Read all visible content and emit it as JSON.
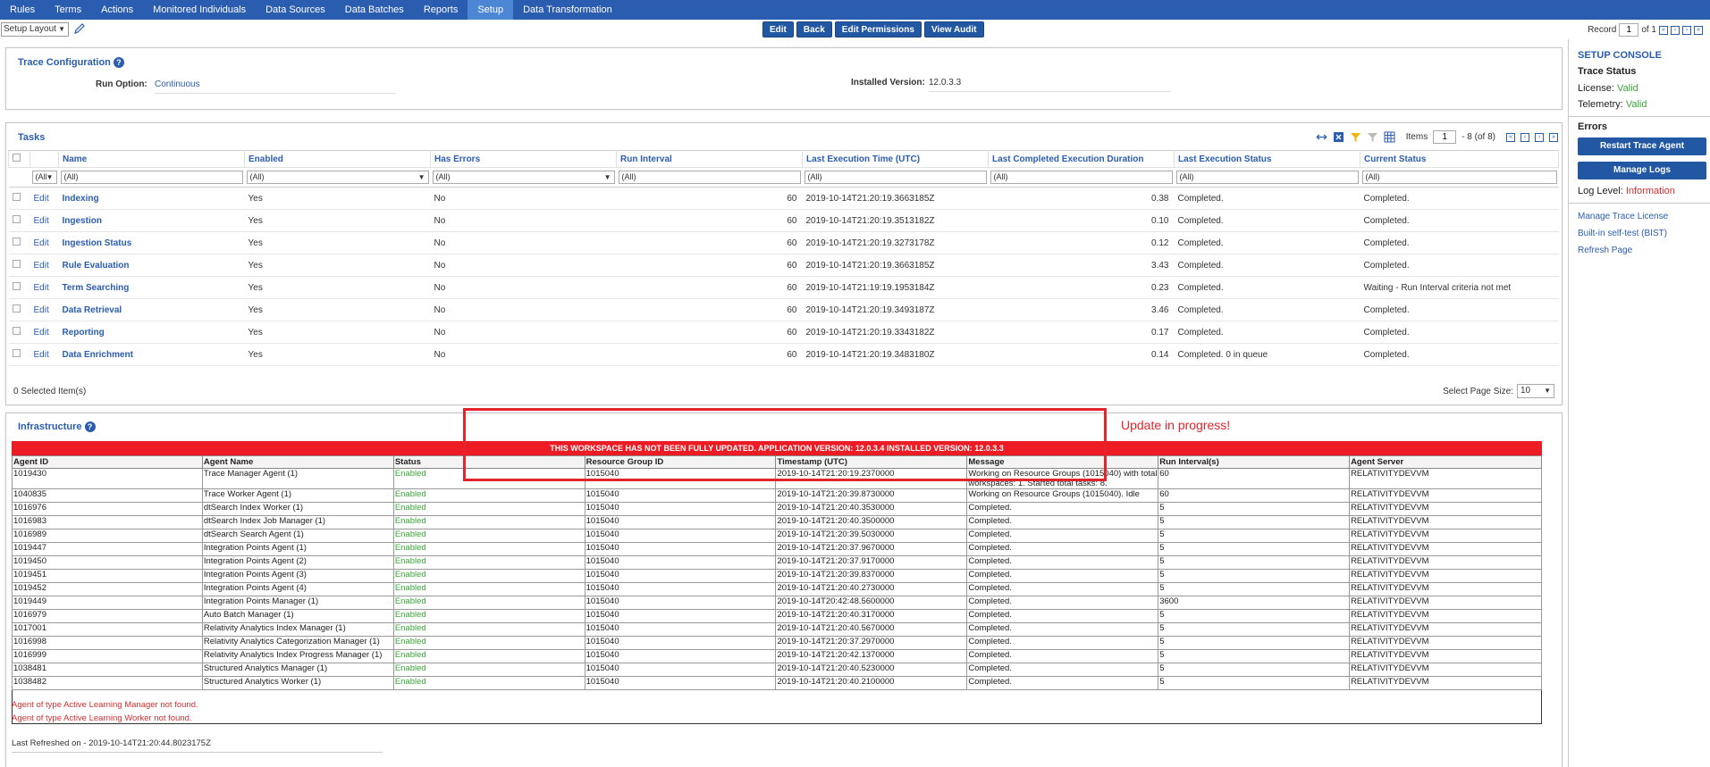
{
  "nav": [
    "Rules",
    "Terms",
    "Actions",
    "Monitored Individuals",
    "Data Sources",
    "Data Batches",
    "Reports",
    "Setup",
    "Data Transformation"
  ],
  "nav_active": "Setup",
  "toolbar": {
    "layout": "Setup Layout",
    "buttons": [
      "Edit",
      "Back",
      "Edit Permissions",
      "View Audit"
    ],
    "record_label": "Record",
    "record_value": "1",
    "record_of": "of 1"
  },
  "trace_config": {
    "title": "Trace Configuration",
    "run_option_label": "Run Option:",
    "run_option_value": "Continuous",
    "installed_version_label": "Installed Version:",
    "installed_version_value": "12.0.3.3"
  },
  "tasks": {
    "title": "Tasks",
    "items_label": "Items",
    "items_page": "1",
    "items_range": "- 8 (of 8)",
    "columns": [
      "Name",
      "Enabled",
      "Has Errors",
      "Run Interval",
      "Last Execution Time (UTC)",
      "Last Completed Execution Duration",
      "Last Execution Status",
      "Current Status"
    ],
    "filter_first": "(All",
    "filter_all": "(All)",
    "edit_label": "Edit",
    "rows": [
      {
        "name": "Indexing",
        "enabled": "Yes",
        "errors": "No",
        "interval": "60",
        "time": "2019-10-14T21:20:19.3663185Z",
        "duration": "0.38",
        "last_status": "Completed.",
        "current": "Completed."
      },
      {
        "name": "Ingestion",
        "enabled": "Yes",
        "errors": "No",
        "interval": "60",
        "time": "2019-10-14T21:20:19.3513182Z",
        "duration": "0.10",
        "last_status": "Completed.",
        "current": "Completed."
      },
      {
        "name": "Ingestion Status",
        "enabled": "Yes",
        "errors": "No",
        "interval": "60",
        "time": "2019-10-14T21:20:19.3273178Z",
        "duration": "0.12",
        "last_status": "Completed.",
        "current": "Completed."
      },
      {
        "name": "Rule Evaluation",
        "enabled": "Yes",
        "errors": "No",
        "interval": "60",
        "time": "2019-10-14T21:20:19.3663185Z",
        "duration": "3.43",
        "last_status": "Completed.",
        "current": "Completed."
      },
      {
        "name": "Term Searching",
        "enabled": "Yes",
        "errors": "No",
        "interval": "60",
        "time": "2019-10-14T21:19:19.1953184Z",
        "duration": "0.23",
        "last_status": "Completed.",
        "current": "Waiting - Run Interval criteria not met"
      },
      {
        "name": "Data Retrieval",
        "enabled": "Yes",
        "errors": "No",
        "interval": "60",
        "time": "2019-10-14T21:20:19.3493187Z",
        "duration": "3.46",
        "last_status": "Completed.",
        "current": "Completed."
      },
      {
        "name": "Reporting",
        "enabled": "Yes",
        "errors": "No",
        "interval": "60",
        "time": "2019-10-14T21:20:19.3343182Z",
        "duration": "0.17",
        "last_status": "Completed.",
        "current": "Completed."
      },
      {
        "name": "Data Enrichment",
        "enabled": "Yes",
        "errors": "No",
        "interval": "60",
        "time": "2019-10-14T21:20:19.3483180Z",
        "duration": "0.14",
        "last_status": "Completed. 0 in queue",
        "current": "Completed."
      }
    ],
    "selected": "0  Selected Item(s)",
    "page_size_label": "Select Page Size:",
    "page_size": "10"
  },
  "infra": {
    "title": "Infrastructure",
    "banner": "THIS WORKSPACE HAS NOT BEEN FULLY UPDATED. APPLICATION VERSION: 12.0.3.4 INSTALLED VERSION: 12.0.3.3",
    "annotation": "Update in progress!",
    "columns": [
      "Agent ID",
      "Agent Name",
      "Status",
      "Resource Group ID",
      "Timestamp (UTC)",
      "Message",
      "Run Interval(s)",
      "Agent Server"
    ],
    "rows": [
      {
        "id": "1019430",
        "name": "Trace Manager Agent (1)",
        "status": "Enabled",
        "rg": "1015040",
        "ts": "2019-10-14T21:20:19.2370000",
        "msg": "Working on Resource Groups (1015040) with total workspaces: 1. Started total tasks: 8.",
        "interval": "60",
        "server": "RELATIVITYDEVVM"
      },
      {
        "id": "1040835",
        "name": "Trace Worker Agent (1)",
        "status": "Enabled",
        "rg": "1015040",
        "ts": "2019-10-14T21:20:39.8730000",
        "msg": "Working on Resource Groups (1015040). Idle",
        "interval": "60",
        "server": "RELATIVITYDEVVM"
      },
      {
        "id": "1016976",
        "name": "dtSearch Index Worker (1)",
        "status": "Enabled",
        "rg": "1015040",
        "ts": "2019-10-14T21:20:40.3530000",
        "msg": "Completed.",
        "interval": "5",
        "server": "RELATIVITYDEVVM"
      },
      {
        "id": "1016983",
        "name": "dtSearch Index Job Manager (1)",
        "status": "Enabled",
        "rg": "1015040",
        "ts": "2019-10-14T21:20:40.3500000",
        "msg": "Completed.",
        "interval": "5",
        "server": "RELATIVITYDEVVM"
      },
      {
        "id": "1016989",
        "name": "dtSearch Search Agent (1)",
        "status": "Enabled",
        "rg": "1015040",
        "ts": "2019-10-14T21:20:39.5030000",
        "msg": "Completed.",
        "interval": "5",
        "server": "RELATIVITYDEVVM"
      },
      {
        "id": "1019447",
        "name": "Integration Points Agent (1)",
        "status": "Enabled",
        "rg": "1015040",
        "ts": "2019-10-14T21:20:37.9670000",
        "msg": "Completed.",
        "interval": "5",
        "server": "RELATIVITYDEVVM"
      },
      {
        "id": "1019450",
        "name": "Integration Points Agent (2)",
        "status": "Enabled",
        "rg": "1015040",
        "ts": "2019-10-14T21:20:37.9170000",
        "msg": "Completed.",
        "interval": "5",
        "server": "RELATIVITYDEVVM"
      },
      {
        "id": "1019451",
        "name": "Integration Points Agent (3)",
        "status": "Enabled",
        "rg": "1015040",
        "ts": "2019-10-14T21:20:39.8370000",
        "msg": "Completed.",
        "interval": "5",
        "server": "RELATIVITYDEVVM"
      },
      {
        "id": "1019452",
        "name": "Integration Points Agent (4)",
        "status": "Enabled",
        "rg": "1015040",
        "ts": "2019-10-14T21:20:40.2730000",
        "msg": "Completed.",
        "interval": "5",
        "server": "RELATIVITYDEVVM"
      },
      {
        "id": "1019449",
        "name": "Integration Points Manager (1)",
        "status": "Enabled",
        "rg": "1015040",
        "ts": "2019-10-14T20:42:48.5600000",
        "msg": "Completed.",
        "interval": "3600",
        "server": "RELATIVITYDEVVM"
      },
      {
        "id": "1016979",
        "name": "Auto Batch Manager (1)",
        "status": "Enabled",
        "rg": "1015040",
        "ts": "2019-10-14T21:20:40.3170000",
        "msg": "Completed.",
        "interval": "5",
        "server": "RELATIVITYDEVVM"
      },
      {
        "id": "1017001",
        "name": "Relativity Analytics Index Manager (1)",
        "status": "Enabled",
        "rg": "1015040",
        "ts": "2019-10-14T21:20:40.5670000",
        "msg": "Completed.",
        "interval": "5",
        "server": "RELATIVITYDEVVM"
      },
      {
        "id": "1016998",
        "name": "Relativity Analytics Categorization Manager (1)",
        "status": "Enabled",
        "rg": "1015040",
        "ts": "2019-10-14T21:20:37.2970000",
        "msg": "Completed.",
        "interval": "5",
        "server": "RELATIVITYDEVVM"
      },
      {
        "id": "1016999",
        "name": "Relativity Analytics Index Progress Manager (1)",
        "status": "Enabled",
        "rg": "1015040",
        "ts": "2019-10-14T21:20:42.1370000",
        "msg": "Completed.",
        "interval": "5",
        "server": "RELATIVITYDEVVM"
      },
      {
        "id": "1038481",
        "name": "Structured Analytics Manager (1)",
        "status": "Enabled",
        "rg": "1015040",
        "ts": "2019-10-14T21:20:40.5230000",
        "msg": "Completed.",
        "interval": "5",
        "server": "RELATIVITYDEVVM"
      },
      {
        "id": "1038482",
        "name": "Structured Analytics Worker (1)",
        "status": "Enabled",
        "rg": "1015040",
        "ts": "2019-10-14T21:20:40.2100000",
        "msg": "Completed.",
        "interval": "5",
        "server": "RELATIVITYDEVVM"
      }
    ],
    "errors": [
      "Agent of type Active Learning Manager not found.",
      "Agent of type Active Learning Worker not found."
    ],
    "last_refreshed": "Last Refreshed on - 2019-10-14T21:20:44.8023175Z"
  },
  "console": {
    "title": "SETUP CONSOLE",
    "trace_status": "Trace Status",
    "license_label": "License:",
    "license_value": "Valid",
    "telemetry_label": "Telemetry:",
    "telemetry_value": "Valid",
    "errors_title": "Errors",
    "restart_button": "Restart Trace Agent",
    "logs_button": "Manage Logs",
    "log_level_label": "Log Level:",
    "log_level_value": "Information",
    "links": [
      "Manage Trace License",
      "Built-in self-test (BIST)",
      "Refresh Page"
    ]
  },
  "colors": {
    "nav": "#2a5db0",
    "button": "#2157a3",
    "banner": "#ed1c24",
    "enabled": "#39a839",
    "error": "#d32f2f"
  }
}
